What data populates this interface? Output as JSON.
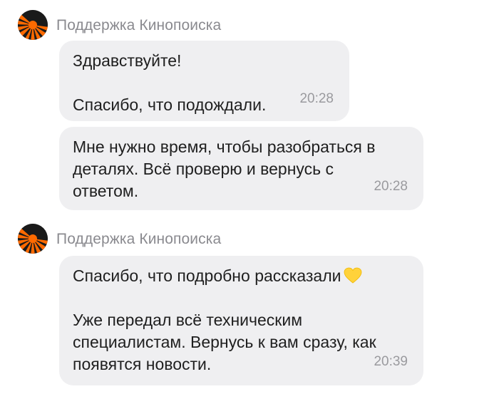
{
  "sender": {
    "name": "Поддержка Кинопоиска",
    "avatar_icon": "kinopoisk-logo-icon"
  },
  "colors": {
    "bubble": "#efeff1",
    "name": "#8a8a8f",
    "time": "#9a9a9e",
    "logo_orange": "#ff6a00",
    "heart": "#ffd23a"
  },
  "groups": [
    {
      "sender_name": "Поддержка Кинопоиска",
      "messages": [
        {
          "text": "Здравствуйте!\n\nСпасибо, что подождали.",
          "time": "20:28"
        },
        {
          "text": "Мне нужно время, чтобы разобраться в деталях. Всё проверю и вернусь с ответом.",
          "time": "20:28"
        }
      ]
    },
    {
      "sender_name": "Поддержка Кинопоиска",
      "messages": [
        {
          "text_before_emoji": "Спасибо, что подробно рассказали",
          "emoji": "yellow-heart-icon",
          "text_after_emoji": "\n\nУже передал всё техническим специалистам. Вернусь к вам сразу, как появятся новости.",
          "time": "20:39"
        }
      ]
    }
  ]
}
